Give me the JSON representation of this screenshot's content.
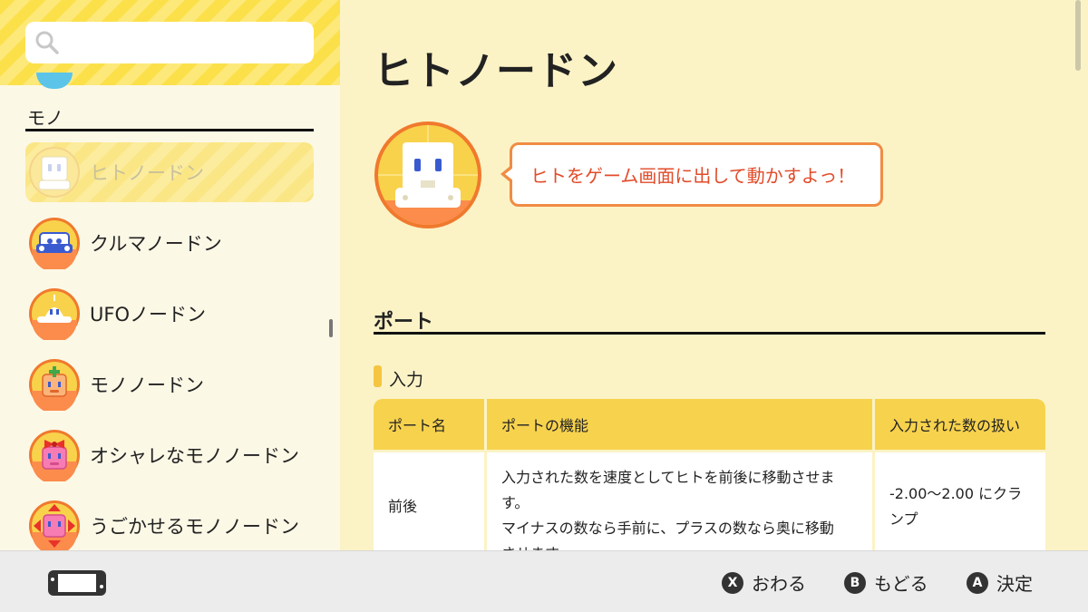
{
  "sidebar": {
    "search": {
      "placeholder": ""
    },
    "section_label": "モノ",
    "items": [
      {
        "label": "ヒトノードン",
        "selected": true,
        "icon": "hito-nodon-icon"
      },
      {
        "label": "クルマノードン",
        "selected": false,
        "icon": "kuruma-nodon-icon"
      },
      {
        "label": "UFOノードン",
        "selected": false,
        "icon": "ufo-nodon-icon"
      },
      {
        "label": "モノノードン",
        "selected": false,
        "icon": "mono-nodon-icon"
      },
      {
        "label": "オシャレなモノノードン",
        "selected": false,
        "icon": "oshare-mono-nodon-icon"
      },
      {
        "label": "うごかせるモノノードン",
        "selected": false,
        "icon": "ugokaseru-mono-nodon-icon"
      }
    ]
  },
  "main": {
    "title": "ヒトノードン",
    "description": "ヒトをゲーム画面に出して動かすよっ！",
    "port_heading": "ポート",
    "input_label": "入力",
    "table": {
      "headers": [
        "ポート名",
        "ポートの機能",
        "入力された数の扱い"
      ],
      "rows": [
        {
          "name": "前後",
          "function_lines": [
            "入力された数を速度としてヒトを前後に移動させま",
            "す。",
            "マイナスの数なら手前に、プラスの数なら奥に移動",
            "させます。"
          ],
          "handling_lines": [
            "-2.00〜2.00 にクラ",
            "ンプ"
          ]
        }
      ]
    }
  },
  "footer": {
    "hints": [
      {
        "button": "X",
        "label": "おわる"
      },
      {
        "button": "B",
        "label": "もどる"
      },
      {
        "button": "A",
        "label": "決定"
      }
    ]
  },
  "colors": {
    "accent_yellow": "#f7d24d",
    "bubble_border": "#f08c44",
    "bubble_text": "#e24b2a",
    "avatar_orange": "#fb8c4c"
  }
}
